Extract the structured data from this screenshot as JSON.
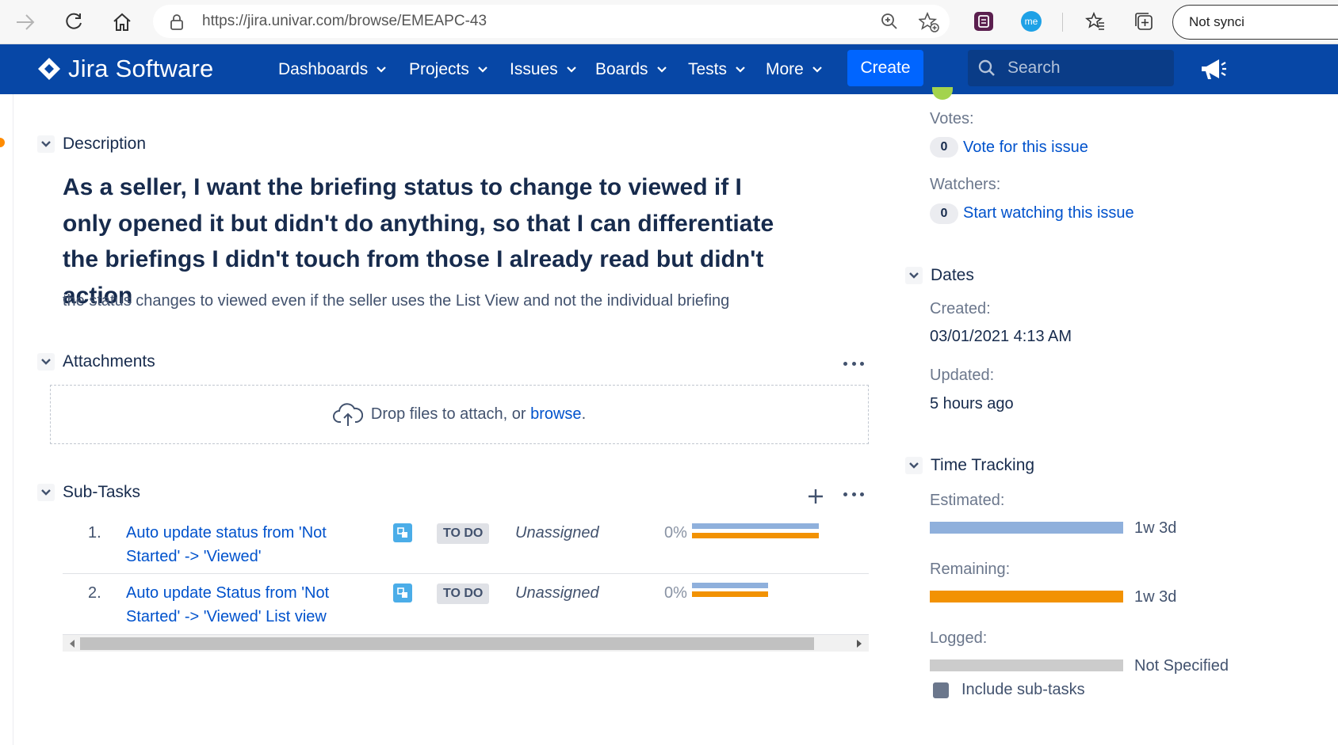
{
  "browser": {
    "url": "https://jira.univar.com/browse/EMEAPC-43",
    "profile_label": "Not synci",
    "ext_label": "me"
  },
  "nav": {
    "logo_text": "Jira Software",
    "items": [
      {
        "label": "Dashboards"
      },
      {
        "label": "Projects"
      },
      {
        "label": "Issues"
      },
      {
        "label": "Boards"
      },
      {
        "label": "Tests"
      },
      {
        "label": "More"
      }
    ],
    "create_label": "Create",
    "search_placeholder": "Search"
  },
  "description": {
    "heading": "Description",
    "summary": "As a seller, I want the briefing status to change to viewed if I only opened it but didn't do anything, so that I can differentiate the briefings I didn't touch from those I already read but didn't action",
    "detail": "the status changes to viewed even if the seller uses the List View and not the individual briefing"
  },
  "attachments": {
    "heading": "Attachments",
    "drop_text": "Drop files to attach, or ",
    "browse_link": "browse",
    "browse_suffix": "."
  },
  "subtasks": {
    "heading": "Sub-Tasks",
    "rows": [
      {
        "num": "1.",
        "title": "Auto update status from 'Not Started' -> 'Viewed'",
        "status": "TO DO",
        "assignee": "Unassigned",
        "progress": "0%",
        "progress_value": 0
      },
      {
        "num": "2.",
        "title": "Auto update Status from 'Not Started' -> 'Viewed' List view",
        "status": "TO DO",
        "assignee": "Unassigned",
        "progress": "0%",
        "progress_value": 0
      }
    ]
  },
  "people": {
    "votes_label": "Votes:",
    "votes_count": "0",
    "vote_link": "Vote for this issue",
    "watchers_label": "Watchers:",
    "watchers_count": "0",
    "watch_link": "Start watching this issue"
  },
  "dates": {
    "heading": "Dates",
    "created_label": "Created:",
    "created_value": "03/01/2021 4:13 AM",
    "updated_label": "Updated:",
    "updated_value": "5 hours ago"
  },
  "time_tracking": {
    "heading": "Time Tracking",
    "estimated_label": "Estimated:",
    "estimated_value": "1w 3d",
    "remaining_label": "Remaining:",
    "remaining_value": "1w 3d",
    "logged_label": "Logged:",
    "logged_value": "Not Specified",
    "include_subtasks_label": "Include sub-tasks"
  },
  "colors": {
    "nav_bg": "#0747a6",
    "create_bg": "#0065ff",
    "link": "#0052cc",
    "estimated": "#8fb0dc",
    "remaining": "#f29203",
    "logged": "#cccccc"
  }
}
